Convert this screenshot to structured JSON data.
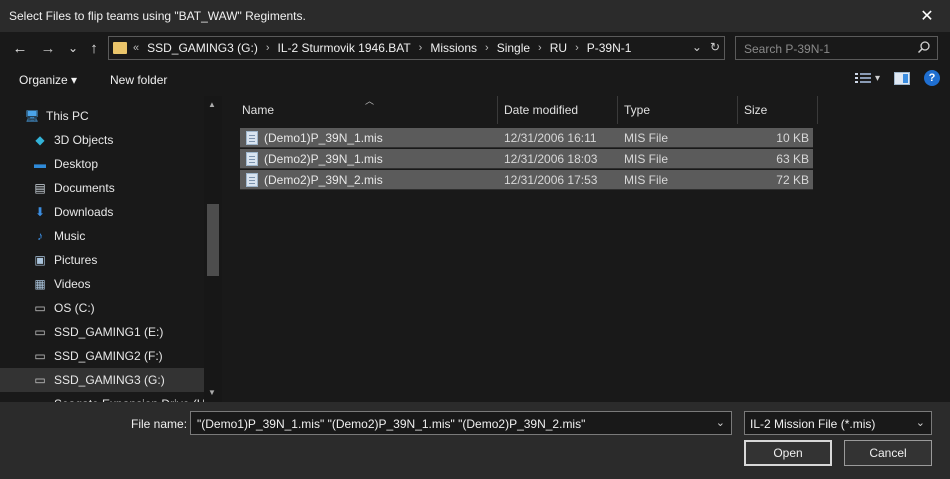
{
  "window": {
    "title": "Select Files to flip teams using \"BAT_WAW\" Regiments.",
    "close_glyph": "✕"
  },
  "nav": {
    "back_glyph": "←",
    "forward_glyph": "→",
    "history_glyph": "⌄",
    "up_glyph": "↑",
    "address": {
      "overflow": "«",
      "segments": [
        "SSD_GAMING3 (G:)",
        "IL-2 Sturmovik 1946.BAT",
        "Missions",
        "Single",
        "RU",
        "P-39N-1"
      ],
      "separator": "›",
      "dropdown_glyph": "⌄",
      "refresh_glyph": "↻"
    },
    "search": {
      "placeholder": "Search P-39N-1",
      "icon": "search-icon"
    }
  },
  "toolbar": {
    "organize_label": "Organize ▾",
    "new_folder_label": "New folder",
    "view_icon": "details-view-icon",
    "view_dropdown": "▾",
    "preview_icon": "preview-pane-icon",
    "help_label": "?"
  },
  "sidebar": {
    "items": [
      {
        "label": "This PC",
        "icon": "pc-icon",
        "glyph": "🖥",
        "color": "#4aa3e8"
      },
      {
        "label": "3D Objects",
        "icon": "cube-icon",
        "glyph": "◆",
        "color": "#33b3d8"
      },
      {
        "label": "Desktop",
        "icon": "desktop-icon",
        "glyph": "▬",
        "color": "#2f8ad8"
      },
      {
        "label": "Documents",
        "icon": "document-icon",
        "glyph": "▤",
        "color": "#cfd8e0"
      },
      {
        "label": "Downloads",
        "icon": "download-icon",
        "glyph": "⬇",
        "color": "#3b8de0"
      },
      {
        "label": "Music",
        "icon": "music-icon",
        "glyph": "♪",
        "color": "#3b8de0"
      },
      {
        "label": "Pictures",
        "icon": "pictures-icon",
        "glyph": "▣",
        "color": "#aac4dc"
      },
      {
        "label": "Videos",
        "icon": "videos-icon",
        "glyph": "▦",
        "color": "#aac4dc"
      },
      {
        "label": "OS (C:)",
        "icon": "os-drive-icon",
        "glyph": "▭",
        "color": "#c8c8c8"
      },
      {
        "label": "SSD_GAMING1 (E:)",
        "icon": "drive-icon",
        "glyph": "▭",
        "color": "#c8c8c8"
      },
      {
        "label": "SSD_GAMING2 (F:)",
        "icon": "drive-icon",
        "glyph": "▭",
        "color": "#c8c8c8"
      },
      {
        "label": "SSD_GAMING3 (G:)",
        "icon": "drive-icon",
        "glyph": "▭",
        "color": "#c8c8c8"
      },
      {
        "label": "Seagate Expansion Drive (H:)",
        "icon": "drive-icon",
        "glyph": "▭",
        "color": "#c8c8c8"
      }
    ],
    "selected_index": 11
  },
  "columns": {
    "name": "Name",
    "date": "Date modified",
    "type": "Type",
    "size": "Size"
  },
  "files": [
    {
      "name": "(Demo1)P_39N_1.mis",
      "date": "12/31/2006 16:11",
      "type": "MIS File",
      "size": "10 KB"
    },
    {
      "name": "(Demo2)P_39N_1.mis",
      "date": "12/31/2006 18:03",
      "type": "MIS File",
      "size": "63 KB"
    },
    {
      "name": "(Demo2)P_39N_2.mis",
      "date": "12/31/2006 17:53",
      "type": "MIS File",
      "size": "72 KB"
    }
  ],
  "footer": {
    "file_name_label": "File name:",
    "file_name_value": "\"(Demo1)P_39N_1.mis\" \"(Demo2)P_39N_1.mis\" \"(Demo2)P_39N_2.mis\"",
    "filter_value": "IL-2 Mission File (*.mis)",
    "dropdown_glyph": "⌄",
    "open_label": "Open",
    "cancel_label": "Cancel"
  }
}
